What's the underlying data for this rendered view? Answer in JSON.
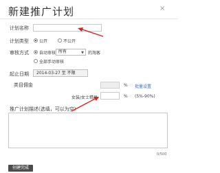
{
  "dialog": {
    "title": "新建推广计划",
    "close_label": "×"
  },
  "form": {
    "plan_name": {
      "label": "计划名称",
      "value": ""
    },
    "plan_type": {
      "label": "计划类型",
      "options": [
        {
          "label": "公开",
          "selected": true
        },
        {
          "label": "不公开",
          "selected": false
        }
      ]
    },
    "review": {
      "label": "审核方式",
      "auto_label": "自动审核",
      "auto_selected": true,
      "select_value": "所有",
      "select_suffix": "的淘客",
      "manual_label": "全部手动审核",
      "manual_selected": false
    },
    "start_date": {
      "label": "起止日期",
      "value": "2014-03-27 至 不限"
    },
    "commission": {
      "label": "类目佣金",
      "percent_sign": "%",
      "batch_link": "批量设置",
      "category_label": "女装/女士精品",
      "category_percent": "%",
      "range_hint": "(5%-90%)"
    },
    "description": {
      "label": "推广计划描述(选填，可以为空)",
      "counter": "0/500"
    }
  },
  "footer": {
    "create_button": "创建完成"
  },
  "colors": {
    "annotation_arrow": "#e02020",
    "button_bg": "#4d4d4d",
    "link": "#3b6fc9"
  }
}
